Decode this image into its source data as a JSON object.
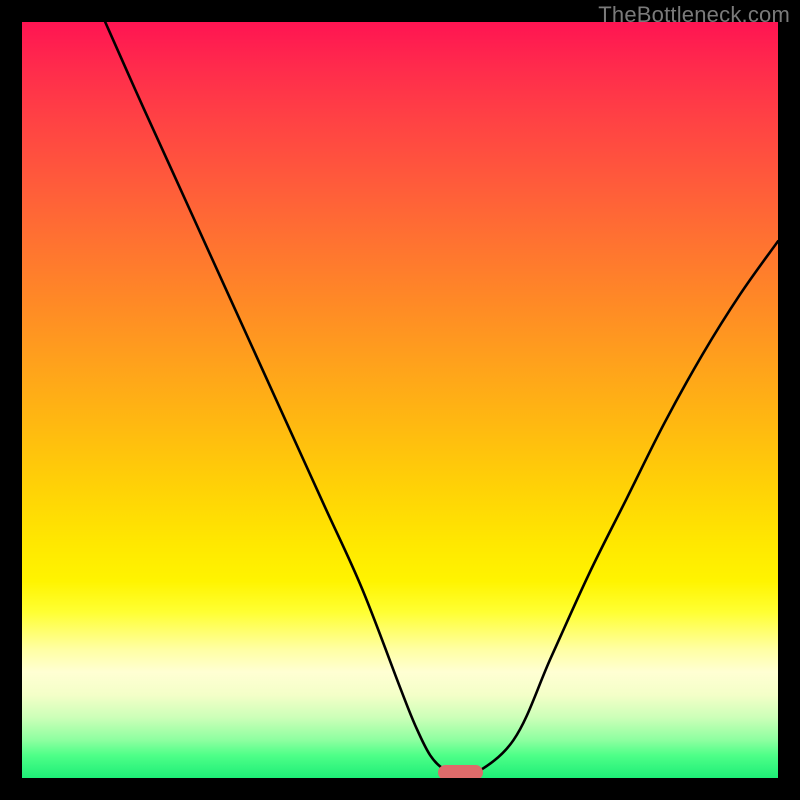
{
  "watermark": "TheBottleneck.com",
  "chart_data": {
    "type": "line",
    "title": "",
    "xlabel": "",
    "ylabel": "",
    "x_range": [
      0,
      100
    ],
    "y_range": [
      0,
      100
    ],
    "grid": false,
    "legend": false,
    "background_gradient": {
      "direction": "vertical",
      "stops": [
        {
          "pos": 0.0,
          "color": "#ff1452"
        },
        {
          "pos": 0.5,
          "color": "#ffb811"
        },
        {
          "pos": 0.78,
          "color": "#ffff32"
        },
        {
          "pos": 0.9,
          "color": "#ccffb8"
        },
        {
          "pos": 1.0,
          "color": "#1eee77"
        }
      ]
    },
    "series": [
      {
        "name": "bottleneck-curve",
        "color": "#000000",
        "x": [
          11,
          15,
          20,
          25,
          30,
          35,
          40,
          45,
          50,
          52,
          54,
          56,
          58,
          59,
          65,
          70,
          75,
          80,
          85,
          90,
          95,
          100
        ],
        "y": [
          100,
          91,
          80,
          69,
          58,
          47,
          36,
          25,
          12,
          7,
          3,
          1,
          0,
          0,
          5,
          16,
          27,
          37,
          47,
          56,
          64,
          71
        ]
      }
    ],
    "marker": {
      "name": "optimal-range",
      "color": "#de6b6a",
      "x_start": 55,
      "x_end": 61,
      "y": 0
    }
  }
}
